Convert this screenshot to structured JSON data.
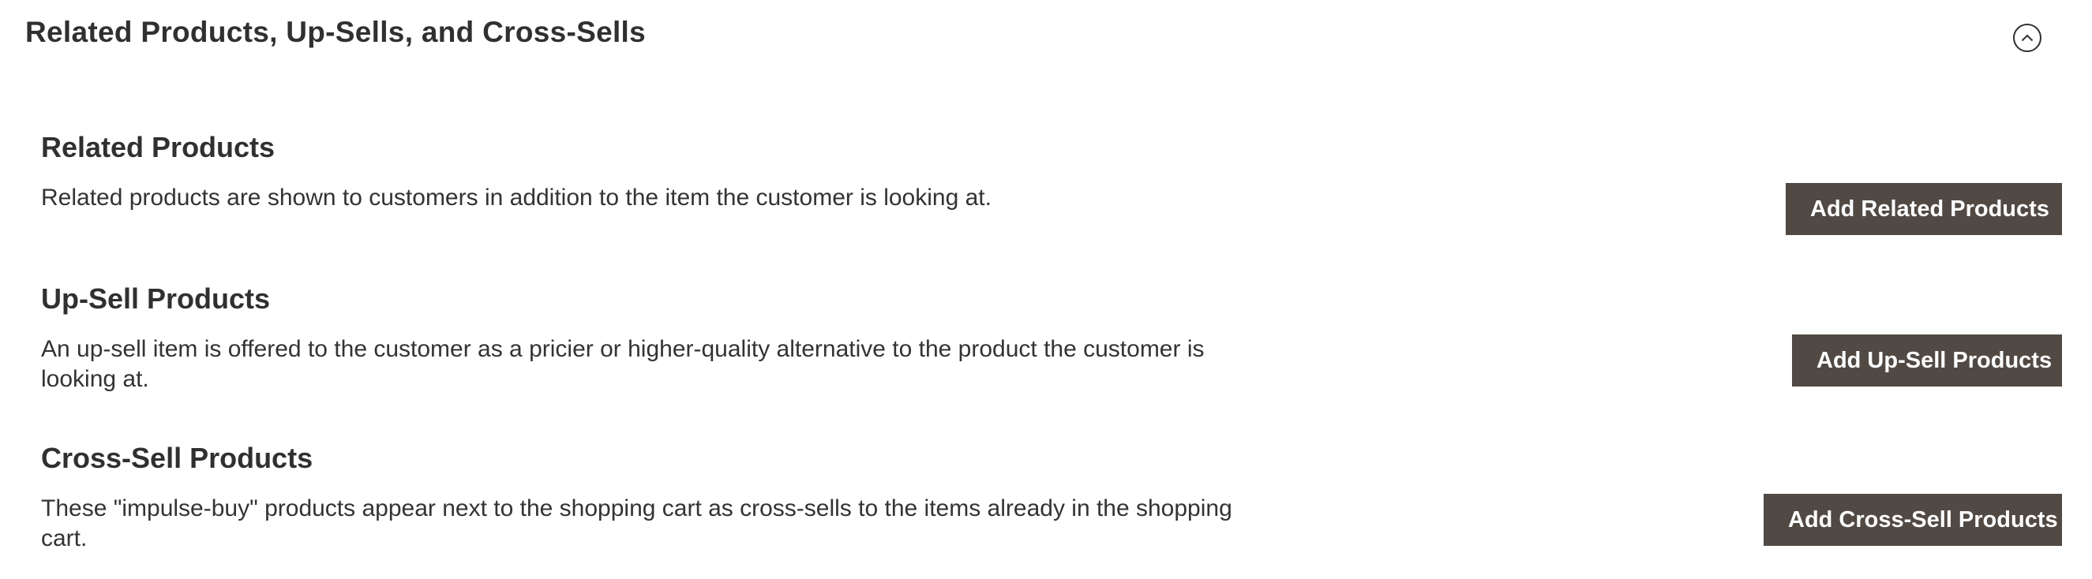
{
  "panel": {
    "title": "Related Products, Up-Sells, and Cross-Sells",
    "toggle_icon": "chevron-up-circle-icon"
  },
  "sections": {
    "related": {
      "heading": "Related Products",
      "description": "Related products are shown to customers in addition to the item the customer is looking at.",
      "button_label": "Add Related Products"
    },
    "upsell": {
      "heading": "Up-Sell Products",
      "description": "An up-sell item is offered to the customer as a pricier or higher-quality alternative to the product the customer is looking at.",
      "button_label": "Add Up-Sell Products"
    },
    "crosssell": {
      "heading": "Cross-Sell Products",
      "description": "These \"impulse-buy\" products appear next to the shopping cart as cross-sells to the items already in the shopping cart.",
      "button_label": "Add Cross-Sell Products"
    }
  },
  "colors": {
    "button_background": "#514943",
    "button_text": "#ffffff",
    "heading_text": "#303030",
    "body_text": "#333333"
  }
}
